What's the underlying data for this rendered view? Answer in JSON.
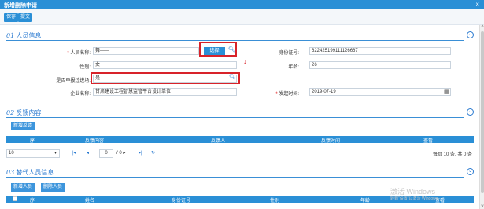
{
  "window": {
    "title": "新增删除申请",
    "close": "×"
  },
  "toolbar": {
    "save": "保存",
    "submit": "提交"
  },
  "sections": [
    {
      "num": "01",
      "title": "人员信息",
      "toggle": "⌄"
    },
    {
      "num": "02",
      "title": "反馈内容",
      "toggle": "⌄"
    },
    {
      "num": "03",
      "title": "替代人员信息",
      "toggle": "⌄"
    }
  ],
  "form": {
    "name_label": "人员名称:",
    "name_value": "舞——",
    "select_btn": "选择",
    "id_label": "身份证号:",
    "id_value": "622425199111126667",
    "gender_label": "性别:",
    "gender_value": "女",
    "age_label": "年龄:",
    "age_value": "26",
    "reported_label": "是否申报过进场:",
    "reported_value": "是",
    "company_label": "企业名称:",
    "company_value": "甘肃建设工程智慧监管平台设计单位",
    "time_label": "发起时间:",
    "time_value": "2019-07-19",
    "required_mark": "*"
  },
  "feedback": {
    "add_btn": "新增反馈",
    "columns": [
      "序",
      "反馈内容",
      "反馈人",
      "反馈时间",
      "查看"
    ],
    "page_size": "10",
    "page_input": "0",
    "page_total": "/ 0 ▸",
    "summary": "每页 10 条, 共 0 条"
  },
  "replacement": {
    "add_btn": "新增人员",
    "delete_btn": "删除人员",
    "columns": [
      "序",
      "姓名",
      "身份证号",
      "性别",
      "年龄",
      "查看"
    ]
  },
  "watermark": {
    "line1": "激活 Windows",
    "line2": "转到\"设置\"以激活 Windows。"
  },
  "icons": {
    "search": "search-icon",
    "calendar": "calendar-icon",
    "arrow": "arrow-down-icon"
  },
  "colors": {
    "accent": "#2a8fd6",
    "highlight": "#d8232a"
  }
}
